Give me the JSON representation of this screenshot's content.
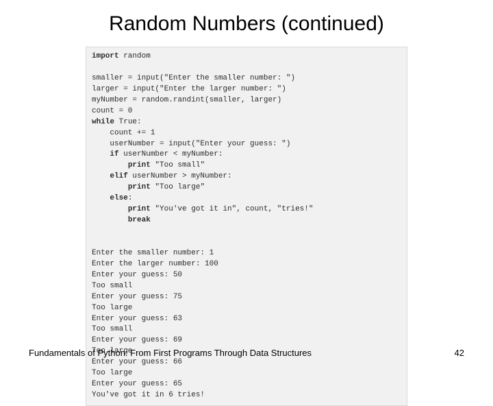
{
  "slide": {
    "title": "Random Numbers (continued)"
  },
  "code": {
    "l01a": "import",
    "l01b": " random",
    "l02": "",
    "l03": "smaller = input(\"Enter the smaller number: \")",
    "l04": "larger = input(\"Enter the larger number: \")",
    "l05": "myNumber = random.randint(smaller, larger)",
    "l06": "count = 0",
    "l07a": "while",
    "l07b": " True:",
    "l08": "    count += 1",
    "l09": "    userNumber = input(\"Enter your guess: \")",
    "l10a": "    ",
    "l10b": "if",
    "l10c": " userNumber < myNumber:",
    "l11a": "        ",
    "l11b": "print",
    "l11c": " \"Too small\"",
    "l12a": "    ",
    "l12b": "elif",
    "l12c": " userNumber > myNumber:",
    "l13a": "        ",
    "l13b": "print",
    "l13c": " \"Too large\"",
    "l14a": "    ",
    "l14b": "else",
    "l14c": ":",
    "l15a": "        ",
    "l15b": "print",
    "l15c": " \"You've got it in\", count, \"tries!\"",
    "l16a": "        ",
    "l16b": "break",
    "l17": "",
    "l18": "",
    "l19": "Enter the smaller number: 1",
    "l20": "Enter the larger number: 100",
    "l21": "Enter your guess: 50",
    "l22": "Too small",
    "l23": "Enter your guess: 75",
    "l24": "Too large",
    "l25": "Enter your guess: 63",
    "l26": "Too small",
    "l27": "Enter your guess: 69",
    "l28": "Too large",
    "l29": "Enter your guess: 66",
    "l30": "Too large",
    "l31": "Enter your guess: 65",
    "l32": "You've got it in 6 tries!"
  },
  "footer": {
    "text": "Fundamentals of Python: From First Programs Through Data Structures",
    "page": "42"
  }
}
